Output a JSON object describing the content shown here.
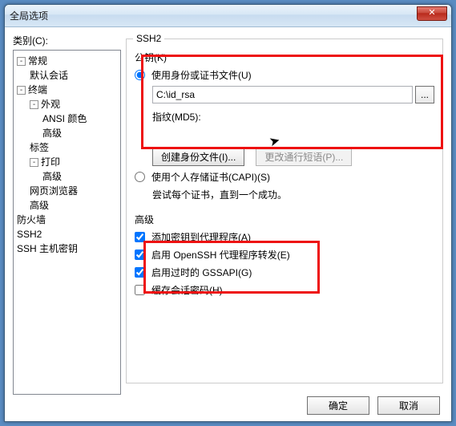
{
  "window": {
    "title": "全局选项"
  },
  "closebtn": "✕",
  "left": {
    "label": "类别(C):",
    "tree": {
      "general": "常规",
      "default_session": "默认会话",
      "terminal": "终端",
      "appearance": "外观",
      "ansi_color": "ANSI 颜色",
      "advanced_appearance": "高级",
      "tabs": "标签",
      "printing": "打印",
      "advanced_printing": "高级",
      "browser": "网页浏览器",
      "advanced_term": "高级",
      "firewall": "防火墙",
      "ssh2": "SSH2",
      "ssh_host_keys": "SSH 主机密钥"
    }
  },
  "panel": {
    "title": "SSH2",
    "pubkey_group": "公钥(K)",
    "use_identity": "使用身份或证书文件(U)",
    "path": "C:\\id_rsa",
    "browse": "...",
    "fingerprint_label": "指纹(MD5):",
    "create_identity_btn": "创建身份文件(I)...",
    "change_passphrase_btn": "更改通行短语(P)...",
    "use_capi": "使用个人存储证书(CAPI)(S)",
    "try_all": "尝试每个证书，直到一个成功。",
    "advanced_label": "高级",
    "add_to_agent": "添加密钥到代理程序(A)",
    "enable_openssh_agent": "启用 OpenSSH 代理程序转发(E)",
    "enable_gssapi": "启用过时的 GSSAPI(G)",
    "cache_pw": "缓存会话密码(H)"
  },
  "footer": {
    "ok": "确定",
    "cancel": "取消"
  }
}
